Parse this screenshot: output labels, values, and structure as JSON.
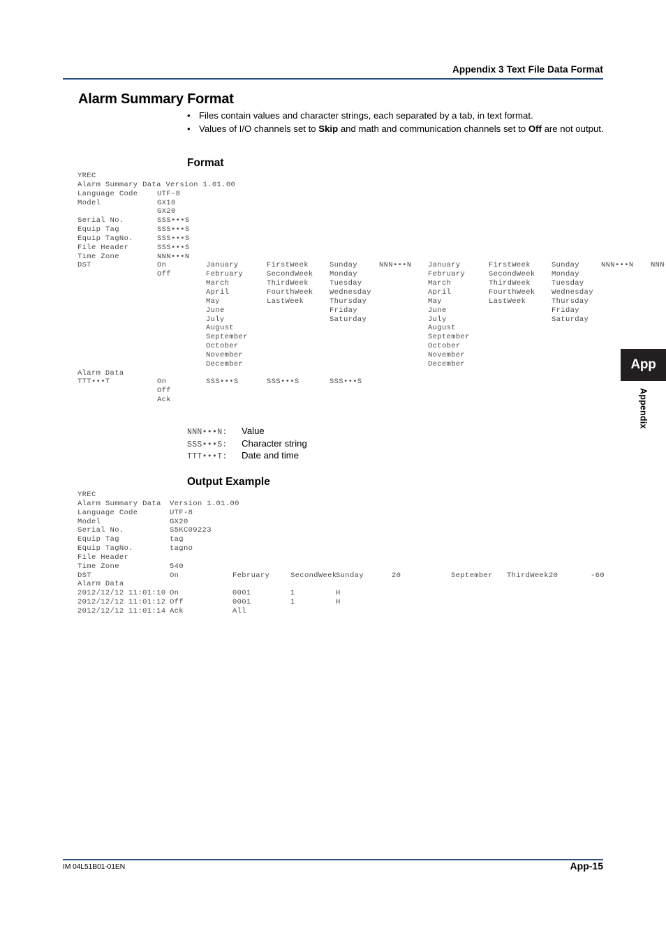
{
  "header": {
    "title": "Appendix 3 Text File Data Format",
    "rule_color": "#2b4f81"
  },
  "heading": "Alarm Summary Format",
  "bullets": [
    {
      "marker": "•",
      "segments": [
        {
          "text": "Files contain values and character strings, each separated by a tab, in text format.",
          "bold": false
        }
      ]
    },
    {
      "marker": "•",
      "segments": [
        {
          "text": "Values of I/O channels set to ",
          "bold": false
        },
        {
          "text": "Skip",
          "bold": true
        },
        {
          "text": " and math and communication channels set to ",
          "bold": false
        },
        {
          "text": "Off",
          "bold": true
        },
        {
          "text": " are not output.",
          "bold": false
        }
      ]
    }
  ],
  "sections": {
    "format": {
      "heading": "Format",
      "lines": [
        [
          "YREC"
        ],
        [
          "Alarm Summary Data Version 1.01.00"
        ],
        [
          "Language Code",
          "UTF-8"
        ],
        [
          "Model",
          "GX10"
        ],
        [
          "",
          "GX20"
        ],
        [
          "Serial No.",
          "SSS•••S"
        ],
        [
          "Equip Tag",
          "SSS•••S"
        ],
        [
          "Equip TagNo.",
          "SSS•••S"
        ],
        [
          "File Header",
          "SSS•••S"
        ],
        [
          "Time Zone",
          "NNN•••N"
        ],
        [
          "DST",
          "On",
          "January",
          "FirstWeek",
          "Sunday",
          "NNN•••N",
          "January",
          "FirstWeek",
          "Sunday",
          "NNN•••N",
          "NNN•••N"
        ],
        [
          "",
          "Off",
          "February",
          "SecondWeek",
          "Monday",
          "",
          "February",
          "SecondWeek",
          "Monday"
        ],
        [
          "",
          "",
          "March",
          "ThirdWeek",
          "Tuesday",
          "",
          "March",
          "ThirdWeek",
          "Tuesday"
        ],
        [
          "",
          "",
          "April",
          "FourthWeek",
          "Wednesday",
          "",
          "April",
          "FourthWeek",
          "Wednesday"
        ],
        [
          "",
          "",
          "May",
          "LastWeek",
          "Thursday",
          "",
          "May",
          "LastWeek",
          "Thursday"
        ],
        [
          "",
          "",
          "June",
          "",
          "Friday",
          "",
          "June",
          "",
          "Friday"
        ],
        [
          "",
          "",
          "July",
          "",
          "Saturday",
          "",
          "July",
          "",
          "Saturday"
        ],
        [
          "",
          "",
          "August",
          "",
          "",
          "",
          "August"
        ],
        [
          "",
          "",
          "September",
          "",
          "",
          "",
          "September"
        ],
        [
          "",
          "",
          "October",
          "",
          "",
          "",
          "October"
        ],
        [
          "",
          "",
          "November",
          "",
          "",
          "",
          "November"
        ],
        [
          "",
          "",
          "December",
          "",
          "",
          "",
          "December"
        ],
        [
          "Alarm Data"
        ],
        [
          "TTT•••T",
          "On",
          "SSS•••S",
          "SSS•••S",
          "SSS•••S"
        ],
        [
          "",
          "Off"
        ],
        [
          "",
          "Ack"
        ]
      ]
    },
    "output_example": {
      "heading": "Output Example",
      "lines": [
        [
          "YREC"
        ],
        [
          "Alarm Summary Data",
          "Version 1.01.00"
        ],
        [
          "Language Code",
          "UTF-8"
        ],
        [
          "Model",
          "GX20"
        ],
        [
          "Serial No.",
          "S5KC09223"
        ],
        [
          "Equip Tag",
          "tag"
        ],
        [
          "Equip TagNo.",
          "tagno"
        ],
        [
          "File Header"
        ],
        [
          "Time Zone",
          "540"
        ],
        [
          "DST",
          "On",
          "February",
          "SecondWeek",
          "Sunday",
          "20",
          "September",
          "ThirdWeek",
          "20",
          "-60"
        ],
        [
          "Alarm Data"
        ],
        [
          "2012/12/12 11:01:10",
          "On",
          "0001",
          "1",
          "H"
        ],
        [
          "2012/12/12 11:01:12",
          "Off",
          "0001",
          "1",
          "H"
        ],
        [
          "2012/12/12 11:01:14",
          "Ack",
          "All"
        ]
      ]
    }
  },
  "legend": [
    {
      "code": "NNN•••N:",
      "desc": "Value"
    },
    {
      "code": "SSS•••S:",
      "desc": "Character string"
    },
    {
      "code": "TTT•••T:",
      "desc": "Date and time"
    }
  ],
  "side_tab": {
    "tab_text": "App",
    "vertical_label": "Appendix",
    "tab_bg": "#231f20"
  },
  "footer": {
    "document_number": "IM 04L51B01-01EN",
    "page_number": "App-15"
  }
}
